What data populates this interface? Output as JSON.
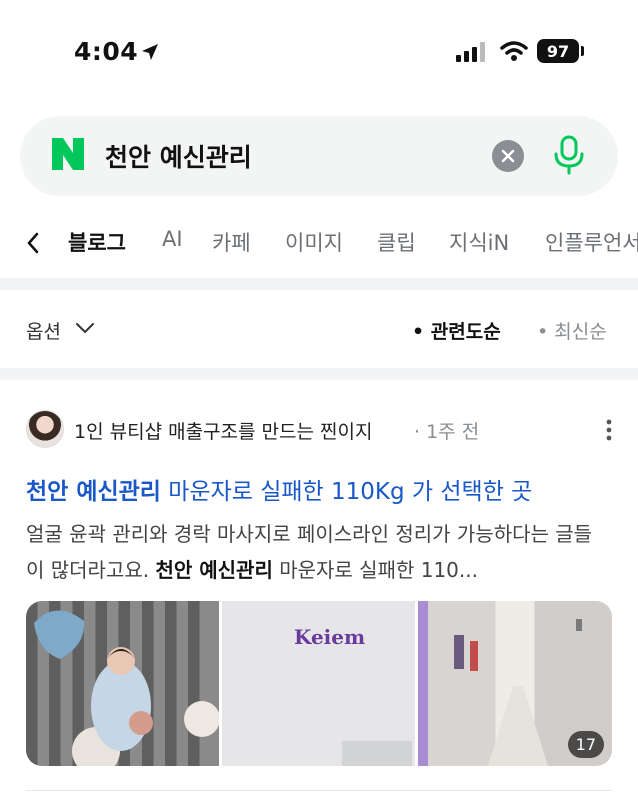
{
  "status": {
    "time": "4:04",
    "battery": "97"
  },
  "search": {
    "query": "천안 예신관리"
  },
  "tabs": [
    {
      "label": "블로그"
    },
    {
      "label": "AI"
    },
    {
      "label": "카페"
    },
    {
      "label": "이미지"
    },
    {
      "label": "클립"
    },
    {
      "label": "지식iN"
    },
    {
      "label": "인플루언서"
    }
  ],
  "options": {
    "label": "옵션",
    "sort_related": "관련도순",
    "sort_latest": "최신순"
  },
  "post": {
    "author": "1인 뷰티샵 매출구조를 만드는 찐이지",
    "ago": "1주 전",
    "title_bold": "천안 예신관리",
    "title_rest": " 마운자로 실패한 110Kg 가 선택한 곳",
    "snippet_1": "얼굴 윤곽 관리와 경락 마사지로 페이스라인 정리가 가능하다는 글들이 많더라고요. ",
    "snippet_bold": "천안 예신관리",
    "snippet_2": " 마운자로 실패한 110...",
    "thumb_count": "17",
    "thumb2_sign": "Keiem"
  },
  "colors": {
    "naver_green": "#03c75a",
    "link_blue": "#1a58c8"
  }
}
